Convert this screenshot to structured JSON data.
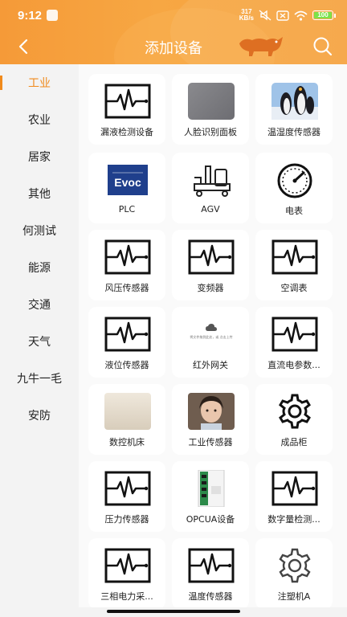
{
  "status_bar": {
    "time": "9:12",
    "net_speed_value": "317",
    "net_speed_unit": "KB/s",
    "battery": "100"
  },
  "header": {
    "title": "添加设备"
  },
  "sidebar": {
    "items": [
      {
        "label": "工业",
        "active": true
      },
      {
        "label": "农业",
        "active": false
      },
      {
        "label": "居家",
        "active": false
      },
      {
        "label": "其他",
        "active": false
      },
      {
        "label": "何测试",
        "active": false
      },
      {
        "label": "能源",
        "active": false
      },
      {
        "label": "交通",
        "active": false
      },
      {
        "label": "天气",
        "active": false
      },
      {
        "label": "九牛一毛",
        "active": false
      },
      {
        "label": "安防",
        "active": false
      }
    ]
  },
  "devices": [
    {
      "label": "漏液检测设备",
      "icon": "waveform-icon"
    },
    {
      "label": "人脸识别面板",
      "icon": "gray-photo"
    },
    {
      "label": "温湿度传感器",
      "icon": "penguins-photo"
    },
    {
      "label": "PLC",
      "icon": "evoc-logo"
    },
    {
      "label": "AGV",
      "icon": "agv-icon"
    },
    {
      "label": "电表",
      "icon": "meter-gauge-icon"
    },
    {
      "label": "风压传感器",
      "icon": "waveform-icon"
    },
    {
      "label": "变频器",
      "icon": "waveform-icon"
    },
    {
      "label": "空调表",
      "icon": "waveform-icon"
    },
    {
      "label": "液位传感器",
      "icon": "waveform-icon"
    },
    {
      "label": "红外网关",
      "icon": "upload-screenshot"
    },
    {
      "label": "直流电参数...",
      "icon": "waveform-icon"
    },
    {
      "label": "数控机床",
      "icon": "paper-photo"
    },
    {
      "label": "工业传感器",
      "icon": "child-photo"
    },
    {
      "label": "成品柜",
      "icon": "gear-icon"
    },
    {
      "label": "压力传感器",
      "icon": "waveform-icon"
    },
    {
      "label": "OPCUA设备",
      "icon": "circuit-board-photo"
    },
    {
      "label": "数字量检测...",
      "icon": "waveform-icon"
    },
    {
      "label": "三相电力采...",
      "icon": "waveform-icon"
    },
    {
      "label": "温度传感器",
      "icon": "waveform-icon"
    },
    {
      "label": "注塑机A",
      "icon": "gear-outline-icon"
    }
  ],
  "evoc_text": "Evoc",
  "upload_hint": "将文件拖到此处，或 点击上传",
  "colors": {
    "accent": "#f08a1c",
    "header": "#f6a23e",
    "battery": "#7be24b"
  }
}
